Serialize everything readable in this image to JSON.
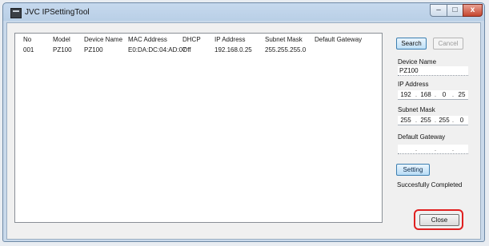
{
  "window": {
    "title": "JVC IPSettingTool",
    "close_glyph": "x"
  },
  "table": {
    "columns": [
      "No",
      "Model",
      "Device Name",
      "MAC Address",
      "DHCP",
      "IP Address",
      "Subnet Mask",
      "Default Gateway"
    ],
    "rows": [
      [
        "001",
        "PZ100",
        "PZ100",
        "E0:DA:DC:04:AD:07",
        "Off",
        "192.168.0.25",
        "255.255.255.0",
        ""
      ]
    ]
  },
  "side": {
    "search_label": "Search",
    "cancel_label": "Cancel",
    "device_name_label": "Device Name",
    "device_name_value": "PZ100",
    "ip_label": "IP Address",
    "ip_parts": [
      "192",
      "168",
      "0",
      "25"
    ],
    "subnet_label": "Subnet Mask",
    "subnet_parts": [
      "255",
      "255",
      "255",
      "0"
    ],
    "gateway_label": "Default Gateway",
    "gateway_parts": [
      "",
      "",
      "",
      ""
    ],
    "setting_label": "Setting",
    "status_text": "Succesfully Completed",
    "close_label": "Close"
  },
  "colors": {
    "highlight_ring": "#e02020",
    "accent_button": "#3c7fb1"
  }
}
